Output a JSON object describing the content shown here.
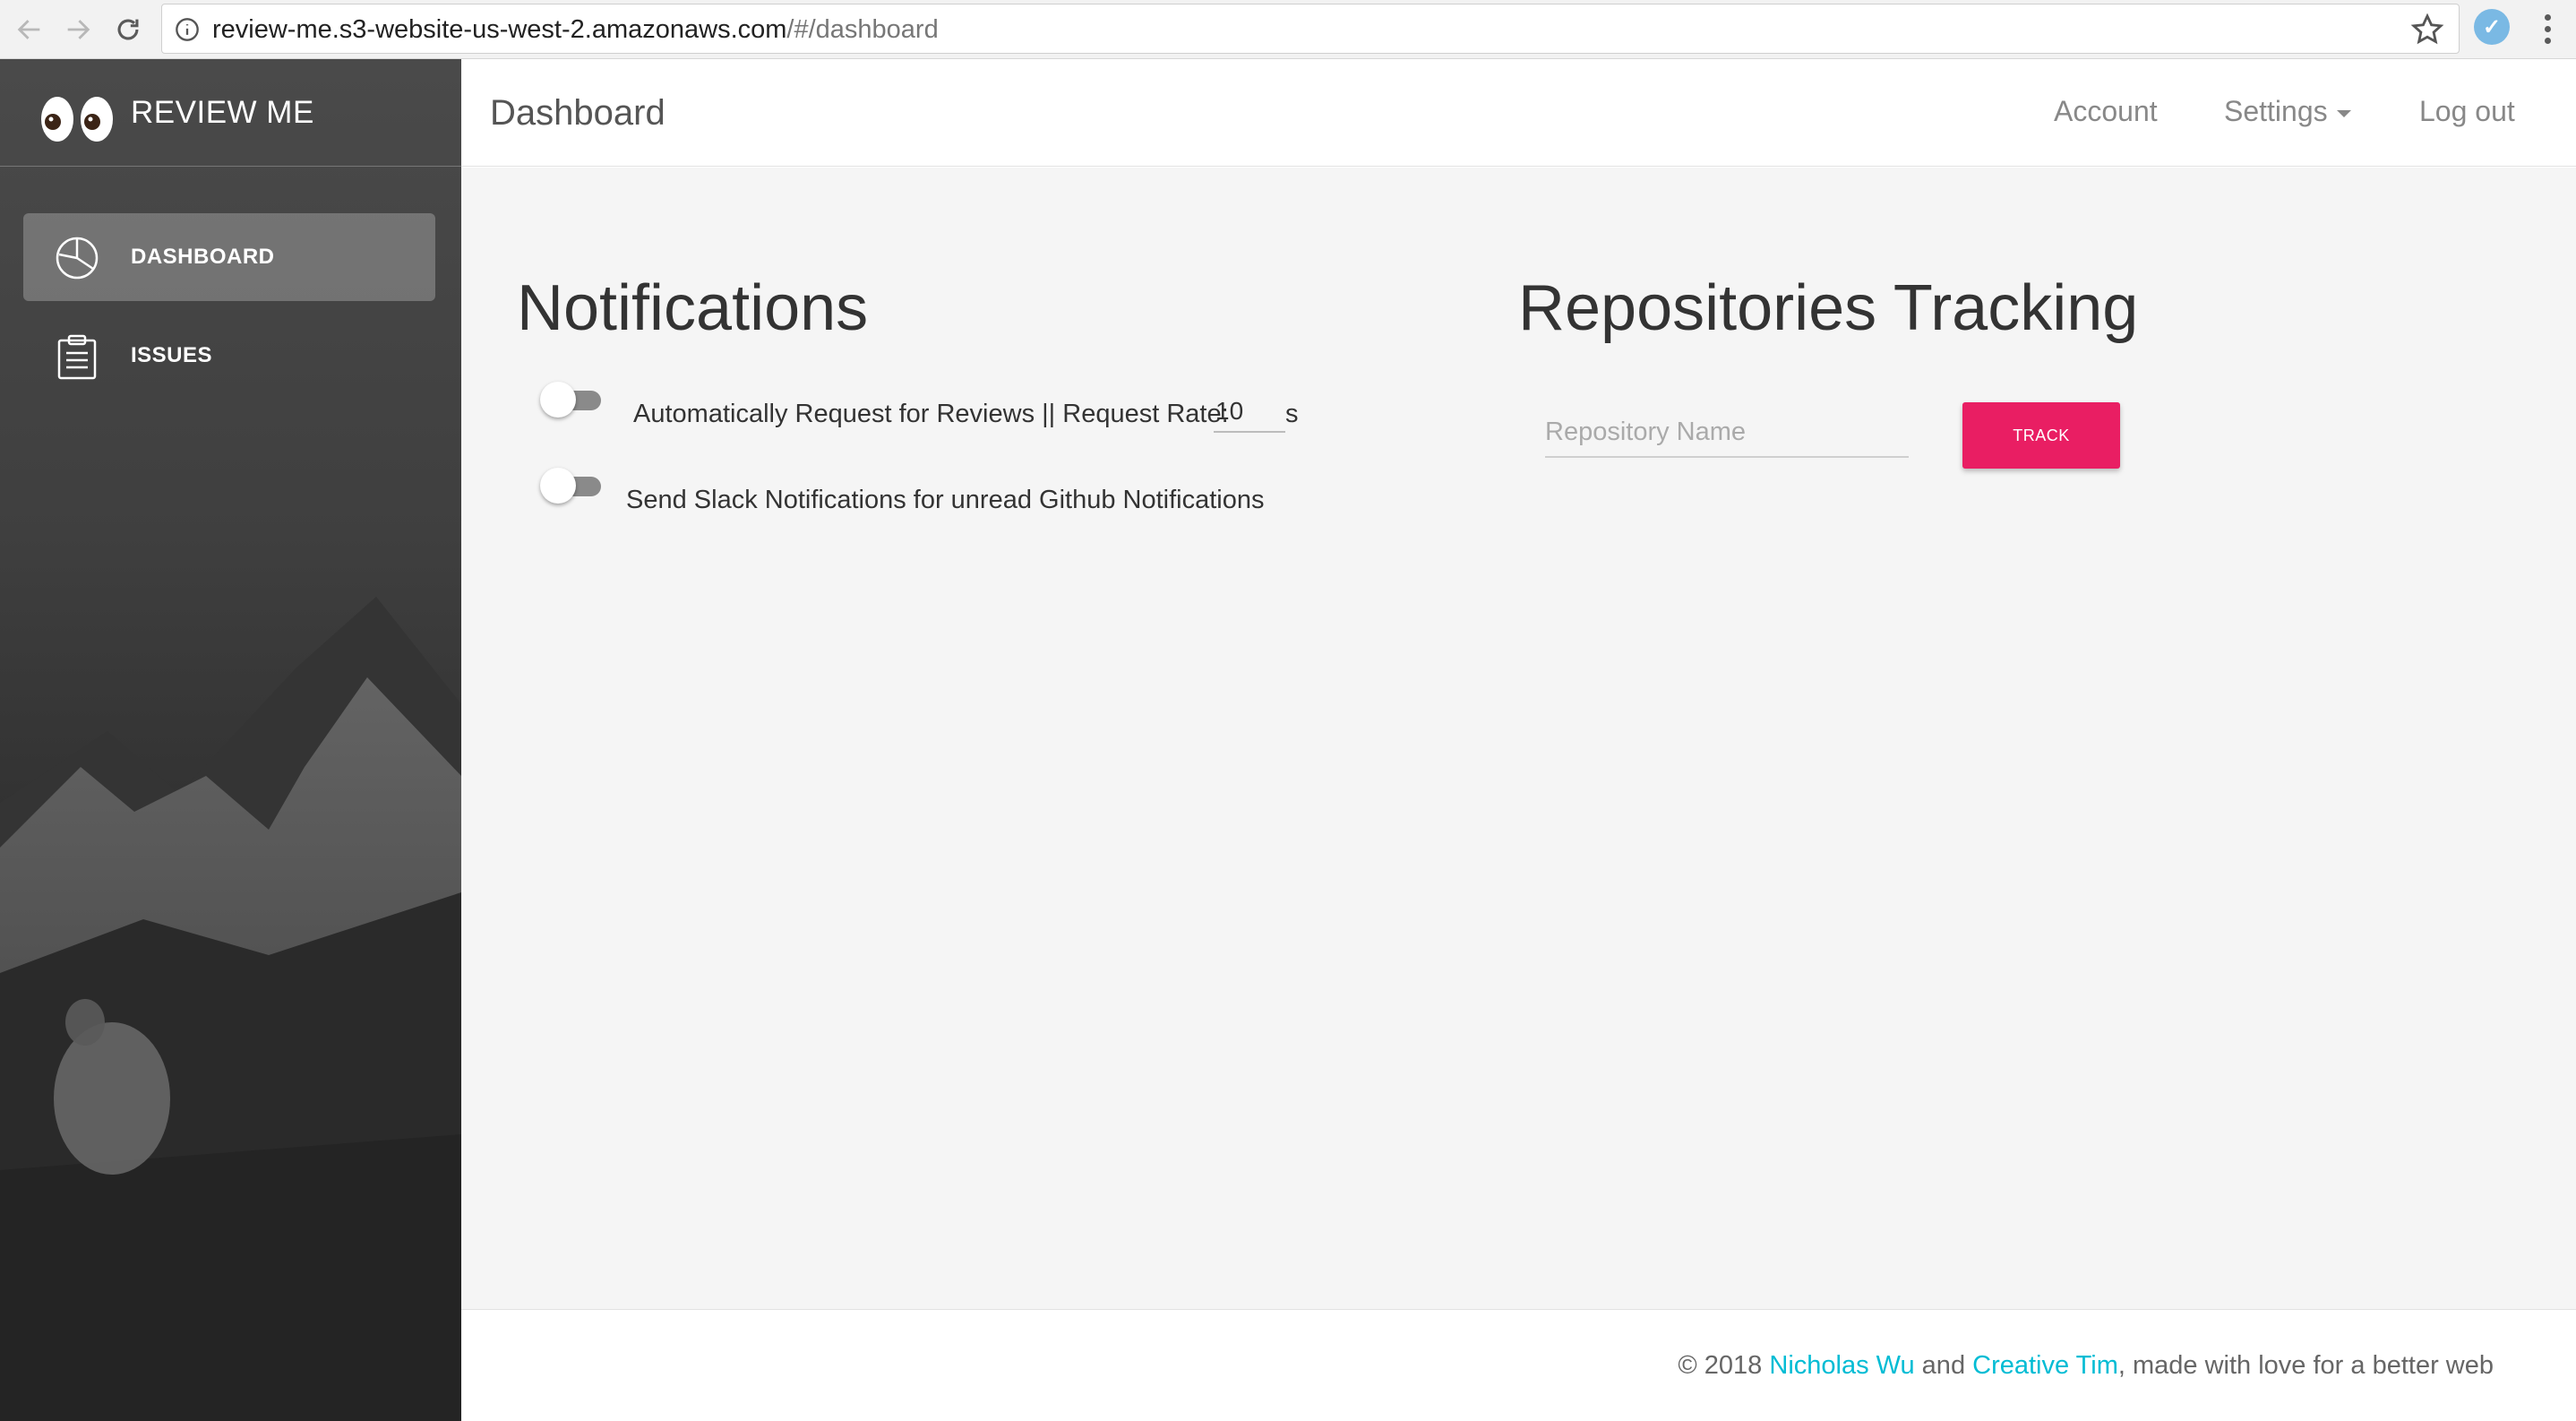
{
  "browser": {
    "url_host": "review-me.s3-website-us-west-2.amazonaws.com",
    "url_path": "/#/dashboard"
  },
  "sidebar": {
    "brand": "REVIEW ME",
    "items": [
      {
        "label": "DASHBOARD",
        "icon": "pie-chart-icon",
        "active": true
      },
      {
        "label": "ISSUES",
        "icon": "clipboard-icon",
        "active": false
      }
    ]
  },
  "navbar": {
    "title": "Dashboard",
    "links": {
      "account": "Account",
      "settings": "Settings",
      "logout": "Log out"
    }
  },
  "notifications": {
    "title": "Notifications",
    "auto_request_label": "Automatically Request for Reviews || Request Rate:",
    "request_rate_value": "10",
    "request_rate_unit": "s",
    "auto_request_enabled": false,
    "slack_label": "Send Slack Notifications for unread Github Notifications",
    "slack_enabled": false
  },
  "repositories": {
    "title": "Repositories Tracking",
    "input_placeholder": "Repository Name",
    "input_value": "",
    "track_button": "TRACK"
  },
  "footer": {
    "prefix": "© 2018 ",
    "author": "Nicholas Wu",
    "connector": " and ",
    "credit": "Creative Tim",
    "suffix": ", made with love for a better web"
  },
  "colors": {
    "accent": "#e91e63",
    "link": "#00bcd4"
  }
}
